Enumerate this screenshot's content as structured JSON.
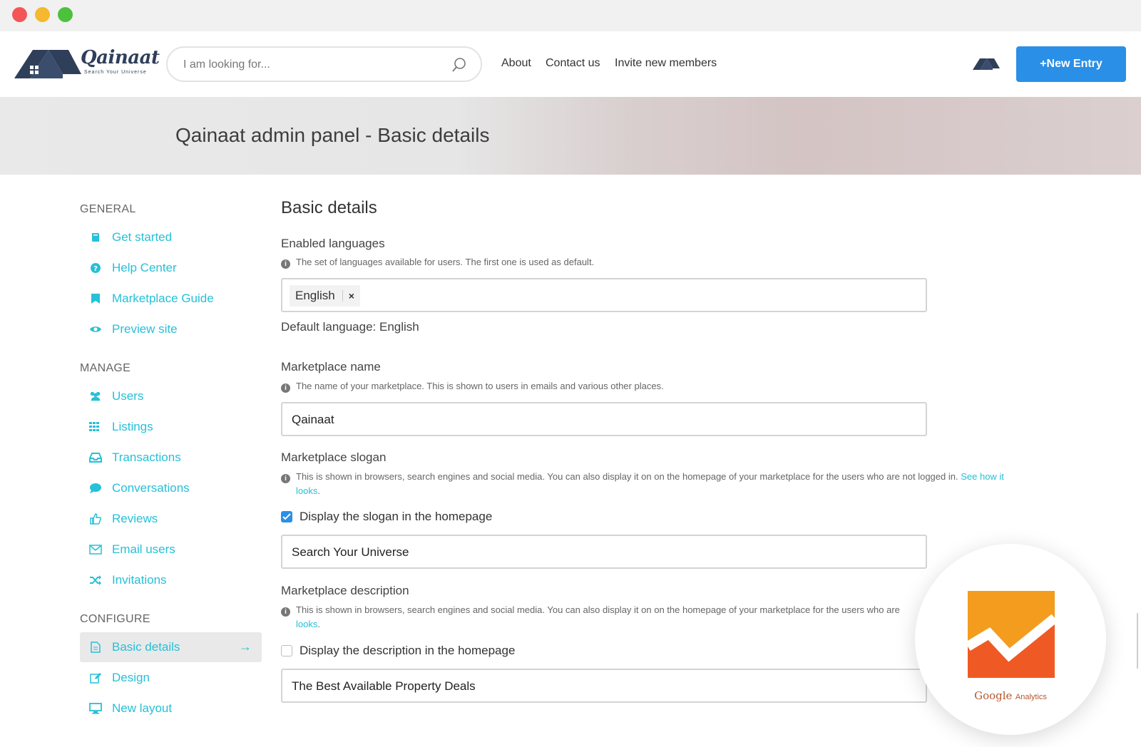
{
  "header": {
    "logo_text": "Qainaat",
    "logo_tagline": "Search Your Universe",
    "search_placeholder": "I am looking for...",
    "nav": [
      "About",
      "Contact us",
      "Invite new members"
    ],
    "new_entry_label": "+New Entry"
  },
  "banner": {
    "title": "Qainaat admin panel - Basic details"
  },
  "sidebar": {
    "general_label": "GENERAL",
    "general": [
      {
        "label": "Get started",
        "icon": "book-icon"
      },
      {
        "label": "Help Center",
        "icon": "question-circle-icon"
      },
      {
        "label": "Marketplace Guide",
        "icon": "bookmark-icon"
      },
      {
        "label": "Preview site",
        "icon": "eye-icon"
      }
    ],
    "manage_label": "MANAGE",
    "manage": [
      {
        "label": "Users",
        "icon": "users-icon"
      },
      {
        "label": "Listings",
        "icon": "grid-icon"
      },
      {
        "label": "Transactions",
        "icon": "inbox-icon"
      },
      {
        "label": "Conversations",
        "icon": "chat-bubble-icon"
      },
      {
        "label": "Reviews",
        "icon": "thumbs-up-icon"
      },
      {
        "label": "Email users",
        "icon": "envelope-icon"
      },
      {
        "label": "Invitations",
        "icon": "shuffle-icon"
      }
    ],
    "configure_label": "CONFIGURE",
    "configure": [
      {
        "label": "Basic details",
        "icon": "document-icon",
        "active": true
      },
      {
        "label": "Design",
        "icon": "edit-icon"
      },
      {
        "label": "New layout",
        "icon": "monitor-icon"
      }
    ],
    "active_arrow": "→"
  },
  "main": {
    "heading": "Basic details",
    "languages": {
      "label": "Enabled languages",
      "help": "The set of languages available for users. The first one is used as default.",
      "tag": "English",
      "tag_remove": "×",
      "default_text": "Default language: English"
    },
    "name": {
      "label": "Marketplace name",
      "help": "The name of your marketplace. This is shown to users in emails and various other places.",
      "value": "Qainaat"
    },
    "slogan": {
      "label": "Marketplace slogan",
      "help": "This is shown in browsers, search engines and social media. You can also display it on on the homepage of your marketplace for the users who are not logged in.",
      "link_a": "See how it",
      "link_b": "looks",
      "checkbox_label": "Display the slogan in the homepage",
      "checked": true,
      "value": "Search Your Universe"
    },
    "description": {
      "label": "Marketplace description",
      "help": "This is shown in browsers, search engines and social media. You can also display it on on the homepage of your marketplace for the users who are",
      "link_b": "looks",
      "checkbox_label": "Display the description in the homepage",
      "checked": false,
      "value": "The Best Available Property Deals"
    }
  },
  "overlay": {
    "google": "Google",
    "analytics": "Analytics"
  },
  "colors": {
    "accent_link": "#26c0d8",
    "button_blue": "#2a8fe6",
    "ga_orange": "#f39c1e",
    "ga_red": "#ef5a24"
  }
}
